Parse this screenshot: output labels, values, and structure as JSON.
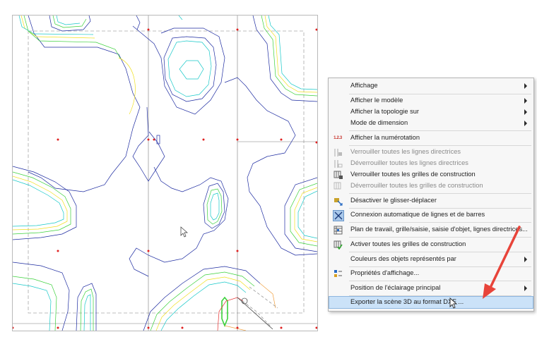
{
  "menu": {
    "items": [
      {
        "label": "Affichage",
        "submenu": true,
        "enabled": true
      },
      {
        "label": "Afficher le modèle",
        "submenu": true,
        "enabled": true
      },
      {
        "label": "Afficher la topologie sur",
        "submenu": true,
        "enabled": true
      },
      {
        "label": "Mode de dimension",
        "submenu": true,
        "enabled": true
      },
      {
        "label": "Afficher la numérotation",
        "icon": "numbering-icon",
        "icon_text": "1.2.3",
        "enabled": true
      },
      {
        "label": "Verrouiller toutes les lignes directrices",
        "icon": "lock-guidelines-icon",
        "enabled": false
      },
      {
        "label": "Déverrouiller toutes les lignes directrices",
        "icon": "unlock-guidelines-icon",
        "enabled": false
      },
      {
        "label": "Verrouiller toutes les grilles de construction",
        "icon": "lock-grid-icon",
        "enabled": true
      },
      {
        "label": "Déverrouiller toutes les grilles de construction",
        "icon": "unlock-grid-icon",
        "enabled": false
      },
      {
        "label": "Désactiver le glisser-déplacer",
        "icon": "drag-drop-icon",
        "enabled": true
      },
      {
        "label": "Connexion automatique de lignes et de barres",
        "icon": "connect-lines-icon",
        "enabled": true
      },
      {
        "label": "Plan de travail, grille/saisie, saisie d'objet, lignes directrices...",
        "icon": "work-plane-icon",
        "enabled": true
      },
      {
        "label": "Activer toutes les grilles de construction",
        "icon": "activate-grid-icon",
        "enabled": true
      },
      {
        "label": "Couleurs des objets représentés par",
        "submenu": true,
        "enabled": true
      },
      {
        "label": "Propriétés d'affichage...",
        "icon": "display-properties-icon",
        "enabled": true
      },
      {
        "label": "Position de l'éclairage principal",
        "submenu": true,
        "enabled": true
      },
      {
        "label": "Exporter la scène 3D au format DXF ...",
        "enabled": true,
        "highlighted": true
      }
    ]
  },
  "colors": {
    "contour_blue": "#1c2aa0",
    "contour_teal": "#16c8c8",
    "contour_green": "#3bd13b",
    "contour_yellow": "#f0e020",
    "contour_orange": "#f0a040",
    "node_red": "#e02020",
    "arrow_red": "#e8443a",
    "menu_highlight": "#cbe2f8"
  }
}
